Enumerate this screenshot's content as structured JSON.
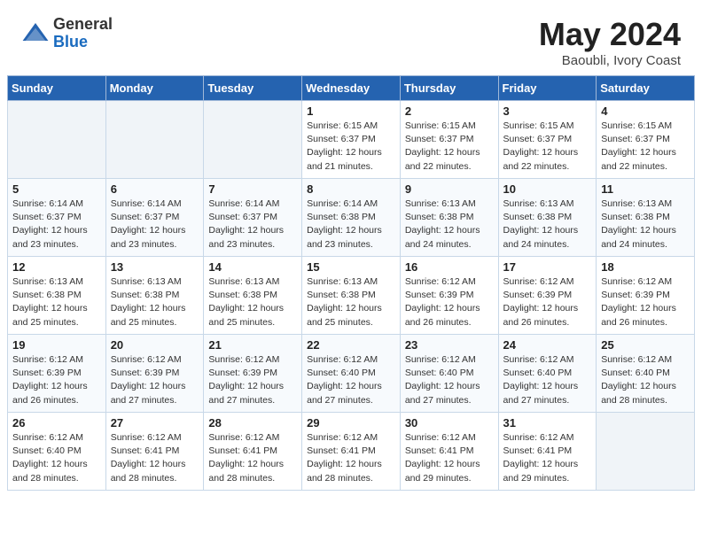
{
  "header": {
    "logo_general": "General",
    "logo_blue": "Blue",
    "title": "May 2024",
    "location": "Baoubli, Ivory Coast"
  },
  "days_of_week": [
    "Sunday",
    "Monday",
    "Tuesday",
    "Wednesday",
    "Thursday",
    "Friday",
    "Saturday"
  ],
  "weeks": [
    [
      {
        "day": "",
        "empty": true
      },
      {
        "day": "",
        "empty": true
      },
      {
        "day": "",
        "empty": true
      },
      {
        "day": "1",
        "sunrise": "6:15 AM",
        "sunset": "6:37 PM",
        "daylight": "12 hours and 21 minutes."
      },
      {
        "day": "2",
        "sunrise": "6:15 AM",
        "sunset": "6:37 PM",
        "daylight": "12 hours and 22 minutes."
      },
      {
        "day": "3",
        "sunrise": "6:15 AM",
        "sunset": "6:37 PM",
        "daylight": "12 hours and 22 minutes."
      },
      {
        "day": "4",
        "sunrise": "6:15 AM",
        "sunset": "6:37 PM",
        "daylight": "12 hours and 22 minutes."
      }
    ],
    [
      {
        "day": "5",
        "sunrise": "6:14 AM",
        "sunset": "6:37 PM",
        "daylight": "12 hours and 23 minutes."
      },
      {
        "day": "6",
        "sunrise": "6:14 AM",
        "sunset": "6:37 PM",
        "daylight": "12 hours and 23 minutes."
      },
      {
        "day": "7",
        "sunrise": "6:14 AM",
        "sunset": "6:37 PM",
        "daylight": "12 hours and 23 minutes."
      },
      {
        "day": "8",
        "sunrise": "6:14 AM",
        "sunset": "6:38 PM",
        "daylight": "12 hours and 23 minutes."
      },
      {
        "day": "9",
        "sunrise": "6:13 AM",
        "sunset": "6:38 PM",
        "daylight": "12 hours and 24 minutes."
      },
      {
        "day": "10",
        "sunrise": "6:13 AM",
        "sunset": "6:38 PM",
        "daylight": "12 hours and 24 minutes."
      },
      {
        "day": "11",
        "sunrise": "6:13 AM",
        "sunset": "6:38 PM",
        "daylight": "12 hours and 24 minutes."
      }
    ],
    [
      {
        "day": "12",
        "sunrise": "6:13 AM",
        "sunset": "6:38 PM",
        "daylight": "12 hours and 25 minutes."
      },
      {
        "day": "13",
        "sunrise": "6:13 AM",
        "sunset": "6:38 PM",
        "daylight": "12 hours and 25 minutes."
      },
      {
        "day": "14",
        "sunrise": "6:13 AM",
        "sunset": "6:38 PM",
        "daylight": "12 hours and 25 minutes."
      },
      {
        "day": "15",
        "sunrise": "6:13 AM",
        "sunset": "6:38 PM",
        "daylight": "12 hours and 25 minutes."
      },
      {
        "day": "16",
        "sunrise": "6:12 AM",
        "sunset": "6:39 PM",
        "daylight": "12 hours and 26 minutes."
      },
      {
        "day": "17",
        "sunrise": "6:12 AM",
        "sunset": "6:39 PM",
        "daylight": "12 hours and 26 minutes."
      },
      {
        "day": "18",
        "sunrise": "6:12 AM",
        "sunset": "6:39 PM",
        "daylight": "12 hours and 26 minutes."
      }
    ],
    [
      {
        "day": "19",
        "sunrise": "6:12 AM",
        "sunset": "6:39 PM",
        "daylight": "12 hours and 26 minutes."
      },
      {
        "day": "20",
        "sunrise": "6:12 AM",
        "sunset": "6:39 PM",
        "daylight": "12 hours and 27 minutes."
      },
      {
        "day": "21",
        "sunrise": "6:12 AM",
        "sunset": "6:39 PM",
        "daylight": "12 hours and 27 minutes."
      },
      {
        "day": "22",
        "sunrise": "6:12 AM",
        "sunset": "6:40 PM",
        "daylight": "12 hours and 27 minutes."
      },
      {
        "day": "23",
        "sunrise": "6:12 AM",
        "sunset": "6:40 PM",
        "daylight": "12 hours and 27 minutes."
      },
      {
        "day": "24",
        "sunrise": "6:12 AM",
        "sunset": "6:40 PM",
        "daylight": "12 hours and 27 minutes."
      },
      {
        "day": "25",
        "sunrise": "6:12 AM",
        "sunset": "6:40 PM",
        "daylight": "12 hours and 28 minutes."
      }
    ],
    [
      {
        "day": "26",
        "sunrise": "6:12 AM",
        "sunset": "6:40 PM",
        "daylight": "12 hours and 28 minutes."
      },
      {
        "day": "27",
        "sunrise": "6:12 AM",
        "sunset": "6:41 PM",
        "daylight": "12 hours and 28 minutes."
      },
      {
        "day": "28",
        "sunrise": "6:12 AM",
        "sunset": "6:41 PM",
        "daylight": "12 hours and 28 minutes."
      },
      {
        "day": "29",
        "sunrise": "6:12 AM",
        "sunset": "6:41 PM",
        "daylight": "12 hours and 28 minutes."
      },
      {
        "day": "30",
        "sunrise": "6:12 AM",
        "sunset": "6:41 PM",
        "daylight": "12 hours and 29 minutes."
      },
      {
        "day": "31",
        "sunrise": "6:12 AM",
        "sunset": "6:41 PM",
        "daylight": "12 hours and 29 minutes."
      },
      {
        "day": "",
        "empty": true
      }
    ]
  ]
}
